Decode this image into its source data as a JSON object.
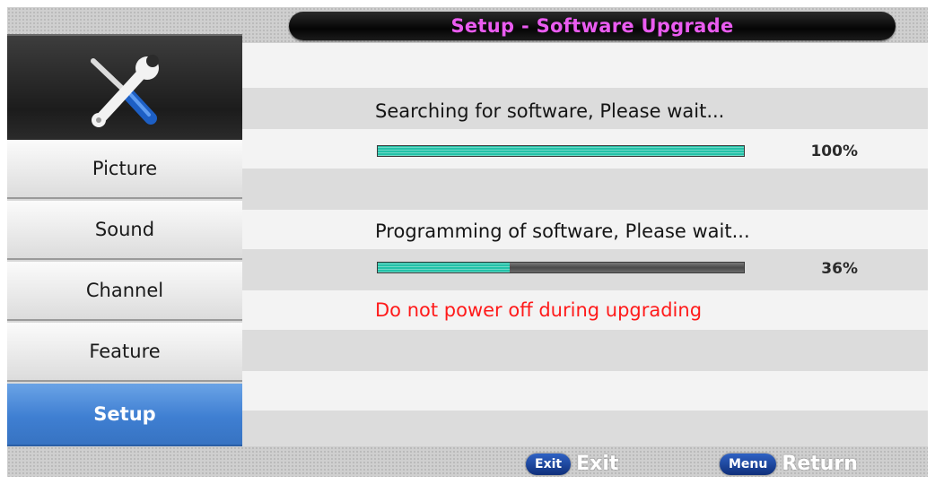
{
  "title": "Setup - Software Upgrade",
  "menu": {
    "icon": "tools-icon",
    "items": [
      {
        "label": "Picture",
        "active": false
      },
      {
        "label": "Sound",
        "active": false
      },
      {
        "label": "Channel",
        "active": false
      },
      {
        "label": "Feature",
        "active": false
      },
      {
        "label": "Setup",
        "active": true
      }
    ]
  },
  "upgrade": {
    "search_label": "Searching for software, Please wait...",
    "search_progress": 100,
    "search_percent": "100%",
    "program_label": "Programming of software, Please wait...",
    "program_progress": 36,
    "program_percent": "36%",
    "warning": "Do not power off during upgrading"
  },
  "footer": {
    "exit_key": "Exit",
    "exit_label": "Exit",
    "menu_key": "Menu",
    "menu_label": "Return"
  },
  "colors": {
    "title_text": "#ea5cf0",
    "active_menu": "#3f7fd2",
    "progress_fill": "#23c2a8",
    "warning_text": "#ff1a1a"
  }
}
